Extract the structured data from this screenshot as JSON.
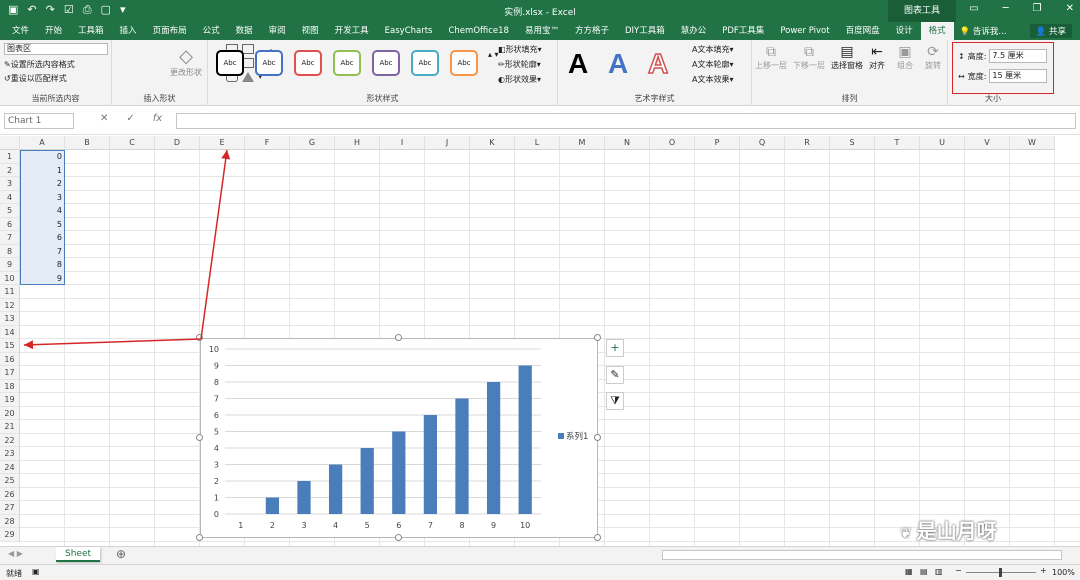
{
  "titlebar": {
    "title": "实例.xlsx - Excel",
    "tool_tab": "图表工具",
    "share": "共享"
  },
  "tabs": [
    "文件",
    "开始",
    "工具箱",
    "插入",
    "页面布局",
    "公式",
    "数据",
    "审阅",
    "视图",
    "开发工具",
    "EasyCharts",
    "ChemOffice18",
    "易用宝™",
    "方方格子",
    "DIY工具箱",
    "慧办公",
    "PDF工具集",
    "Power Pivot",
    "百度网盘",
    "设计",
    "格式"
  ],
  "active_tab": "格式",
  "tell_me": "告诉我...",
  "ribbon": {
    "selection_combo": "图表区",
    "format_selection": "设置所选内容格式",
    "reset_style": "重设以匹配样式",
    "group_current": "当前所选内容",
    "group_insert_shapes": "插入形状",
    "change_shape": "更改形状",
    "shape_style_label": "Abc",
    "shape_fill": "形状填充",
    "shape_outline": "形状轮廓",
    "shape_effect": "形状效果",
    "group_shape_styles": "形状样式",
    "wordart_letter": "A",
    "text_fill": "文本填充",
    "text_outline": "文本轮廓",
    "text_effect": "文本效果",
    "group_wordart": "艺术字样式",
    "bring_forward": "上移一层",
    "send_backward": "下移一层",
    "selection_pane": "选择窗格",
    "align": "对齐",
    "group": "组合",
    "rotate": "旋转",
    "group_arrange": "排列",
    "height_label": "高度:",
    "height_value": "7.5 厘米",
    "width_label": "宽度:",
    "width_value": "15 厘米",
    "group_size": "大小",
    "style_colors": [
      "#000000",
      "#4472c4",
      "#e05050",
      "#92c050",
      "#8064a2",
      "#4bacc6",
      "#f79646"
    ]
  },
  "formula": {
    "namebox": "Chart 1",
    "fx": "fx",
    "cancel": "✕",
    "enter": "✓"
  },
  "columns": [
    "A",
    "B",
    "C",
    "D",
    "E",
    "F",
    "G",
    "H",
    "I",
    "J",
    "K",
    "L",
    "M",
    "N",
    "O",
    "P",
    "Q",
    "R",
    "S",
    "T",
    "U",
    "V",
    "W"
  ],
  "rows": [
    "1",
    "2",
    "3",
    "4",
    "5",
    "6",
    "7",
    "8",
    "9",
    "10",
    "11",
    "12",
    "13",
    "14",
    "15",
    "16",
    "17",
    "18",
    "19",
    "20",
    "21",
    "22",
    "23",
    "24",
    "25",
    "26",
    "27",
    "28",
    "29"
  ],
  "cells_A": [
    "0",
    "1",
    "2",
    "3",
    "4",
    "5",
    "6",
    "7",
    "8",
    "9"
  ],
  "sheet": {
    "tab": "Sheet",
    "add": "⊕"
  },
  "status": {
    "ready": "就绪",
    "zoom": "100%"
  },
  "chart_data": {
    "type": "bar",
    "categories": [
      "1",
      "2",
      "3",
      "4",
      "5",
      "6",
      "7",
      "8",
      "9",
      "10"
    ],
    "series": [
      {
        "name": "系列1",
        "values": [
          0,
          1,
          2,
          3,
          4,
          5,
          6,
          7,
          8,
          9
        ]
      }
    ],
    "ylim": [
      0,
      10
    ],
    "yticks": [
      "0",
      "1",
      "2",
      "3",
      "4",
      "5",
      "6",
      "7",
      "8",
      "9",
      "10"
    ],
    "color": "#4a7ebb",
    "legend": "right",
    "grid": true
  },
  "watermark": "是山月呀"
}
